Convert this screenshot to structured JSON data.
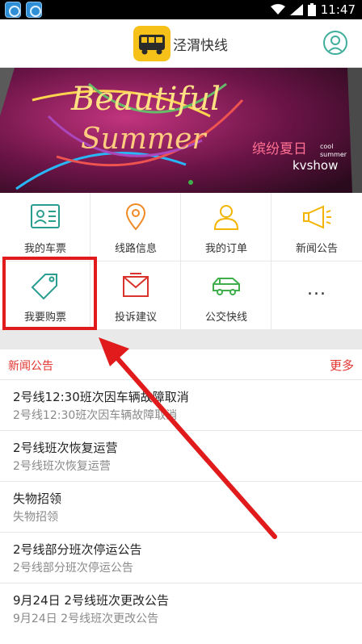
{
  "status_bar": {
    "time": "11:47"
  },
  "app_bar": {
    "title": "泾渭快线",
    "logo_icon": "bus-icon",
    "profile_icon": "user-icon"
  },
  "banner": {
    "headline_1": "Beautiful",
    "headline_2": "Summer",
    "caption_cn": "缤纷夏日",
    "caption_small_1": "cool",
    "caption_small_2": "summer",
    "brand": "kvshow"
  },
  "grid": [
    {
      "label": "我的车票",
      "icon": "id-card-icon",
      "color": "#2a9d8f"
    },
    {
      "label": "线路信息",
      "icon": "map-pin-icon",
      "color": "#f08a24"
    },
    {
      "label": "我的订单",
      "icon": "person-icon",
      "color": "#f4b400"
    },
    {
      "label": "新闻公告",
      "icon": "megaphone-icon",
      "color": "#f4b400"
    },
    {
      "label": "我要购票",
      "icon": "ticket-tag-icon",
      "color": "#2a9d8f"
    },
    {
      "label": "投诉建议",
      "icon": "mail-icon",
      "color": "#d9342b"
    },
    {
      "label": "公交快线",
      "icon": "bus-outline-icon",
      "color": "#3fae4b"
    },
    {
      "label": "...",
      "icon": "more-icon",
      "color": "#333333"
    }
  ],
  "news": {
    "title": "新闻公告",
    "more": "更多",
    "items": [
      {
        "title": "2号线12:30班次因车辆故障取消",
        "subtitle": "2号线12:30班次因车辆故障取消"
      },
      {
        "title": "2号线班次恢复运营",
        "subtitle": "2号线班次恢复运营"
      },
      {
        "title": "失物招领",
        "subtitle": "失物招领"
      },
      {
        "title": "2号线部分班次停运公告",
        "subtitle": "2号线部分班次停运公告"
      },
      {
        "title": "9月24日 2号线班次更改公告",
        "subtitle": "9月24日 2号线班次更改公告"
      }
    ]
  },
  "colors": {
    "accent": "#e3342f",
    "highlight": "#e11b1b",
    "logo": "#f6c21a"
  }
}
